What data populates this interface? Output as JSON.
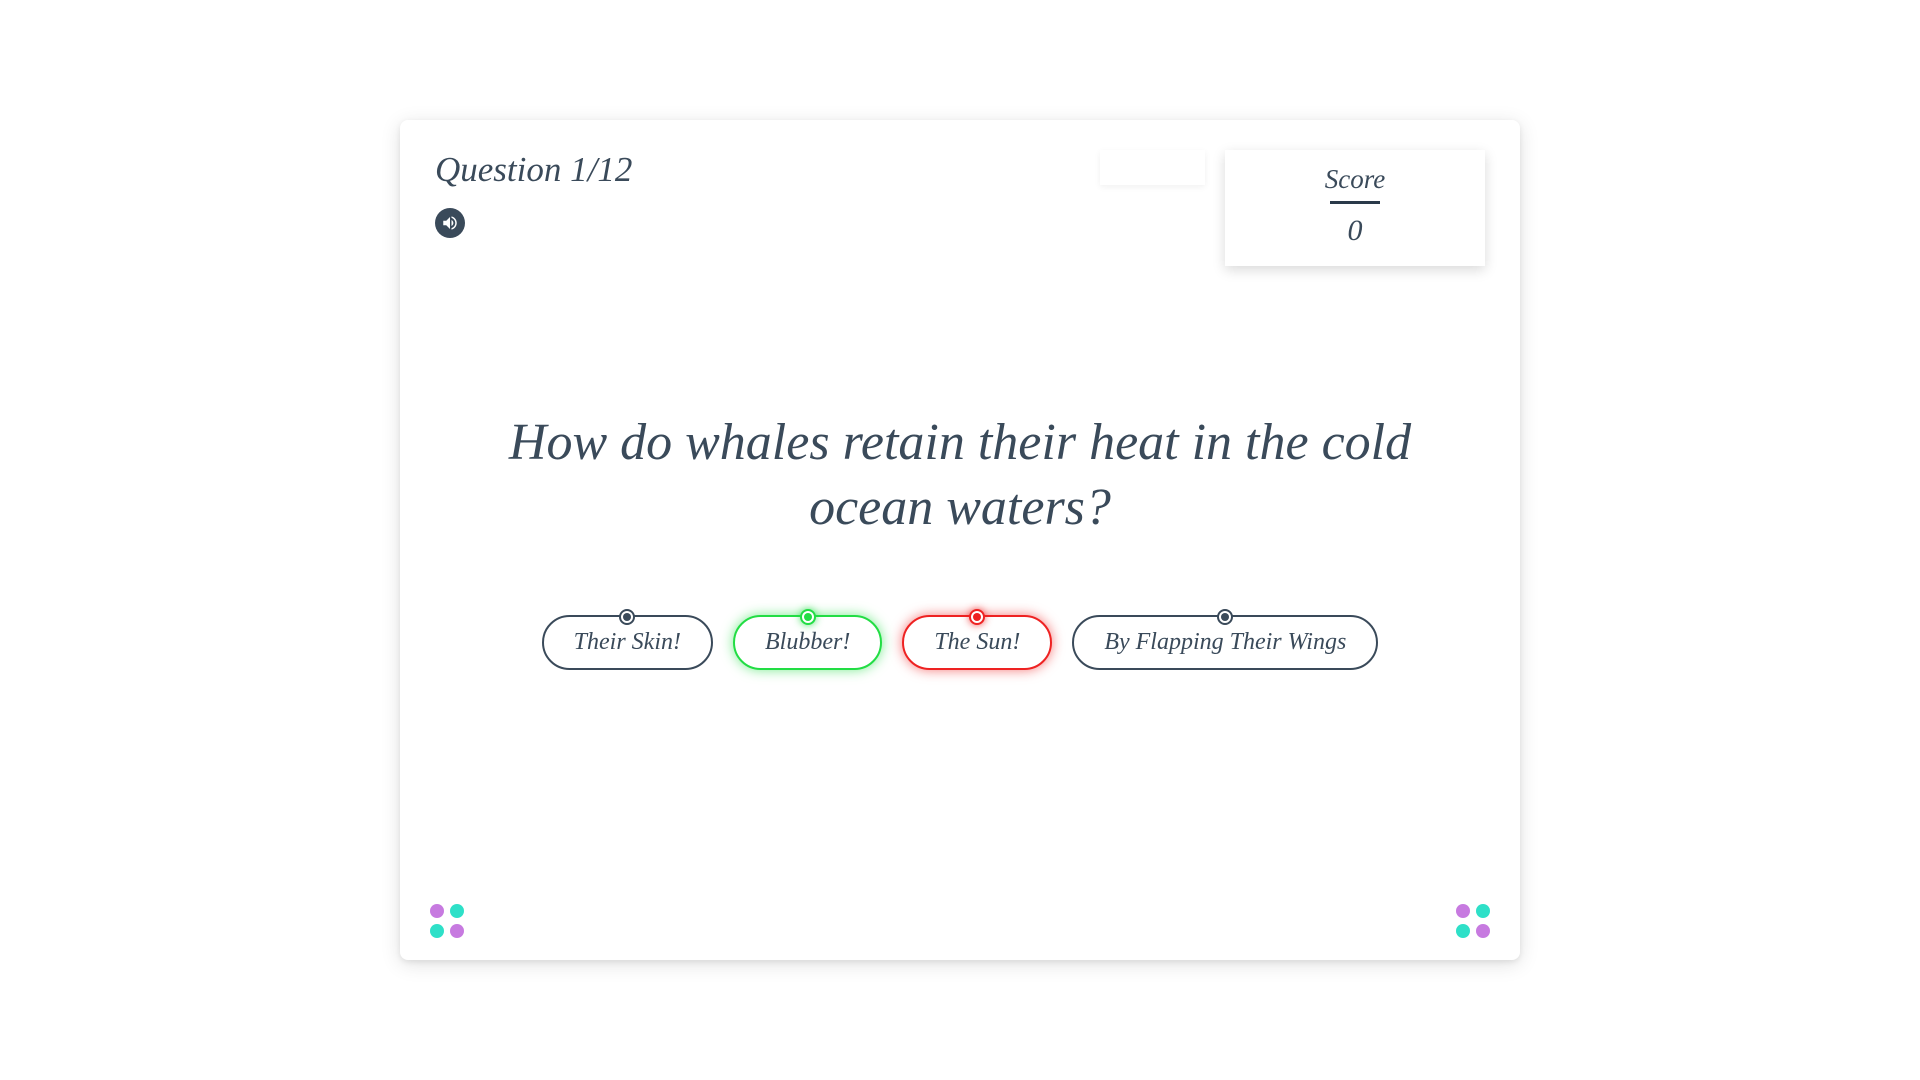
{
  "header": {
    "question_counter": "Question 1/12",
    "score_label": "Score",
    "score_value": "0"
  },
  "question": {
    "text": "How do whales retain their heat in the cold ocean waters?"
  },
  "answers": [
    {
      "label": "Their Skin!",
      "state": "neutral"
    },
    {
      "label": "Blubber!",
      "state": "correct"
    },
    {
      "label": "The Sun!",
      "state": "wrong"
    },
    {
      "label": "By Flapping Their Wings",
      "state": "neutral"
    }
  ],
  "decoration": {
    "dot_colors": [
      "purple",
      "teal",
      "teal",
      "purple"
    ]
  }
}
